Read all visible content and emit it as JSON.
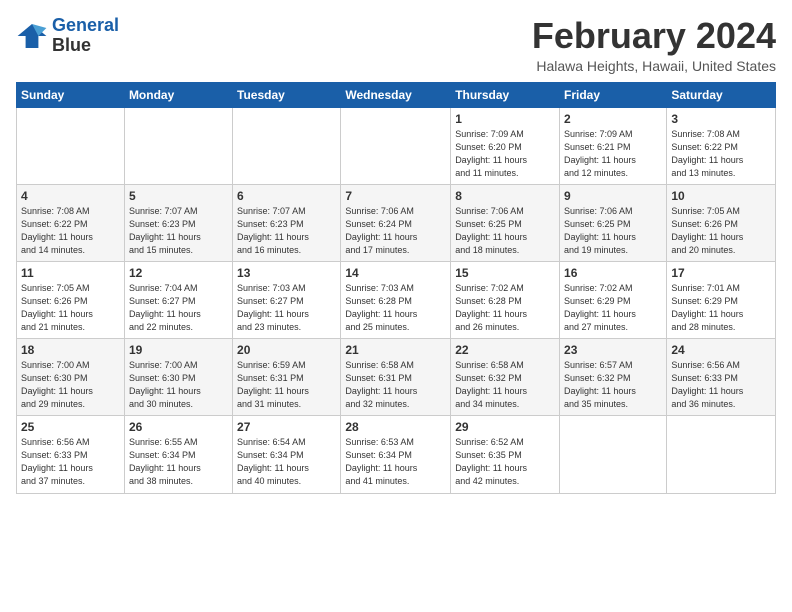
{
  "header": {
    "logo_line1": "General",
    "logo_line2": "Blue",
    "month_year": "February 2024",
    "location": "Halawa Heights, Hawaii, United States"
  },
  "calendar": {
    "days_of_week": [
      "Sunday",
      "Monday",
      "Tuesday",
      "Wednesday",
      "Thursday",
      "Friday",
      "Saturday"
    ],
    "weeks": [
      [
        {
          "day": "",
          "info": ""
        },
        {
          "day": "",
          "info": ""
        },
        {
          "day": "",
          "info": ""
        },
        {
          "day": "",
          "info": ""
        },
        {
          "day": "1",
          "info": "Sunrise: 7:09 AM\nSunset: 6:20 PM\nDaylight: 11 hours\nand 11 minutes."
        },
        {
          "day": "2",
          "info": "Sunrise: 7:09 AM\nSunset: 6:21 PM\nDaylight: 11 hours\nand 12 minutes."
        },
        {
          "day": "3",
          "info": "Sunrise: 7:08 AM\nSunset: 6:22 PM\nDaylight: 11 hours\nand 13 minutes."
        }
      ],
      [
        {
          "day": "4",
          "info": "Sunrise: 7:08 AM\nSunset: 6:22 PM\nDaylight: 11 hours\nand 14 minutes."
        },
        {
          "day": "5",
          "info": "Sunrise: 7:07 AM\nSunset: 6:23 PM\nDaylight: 11 hours\nand 15 minutes."
        },
        {
          "day": "6",
          "info": "Sunrise: 7:07 AM\nSunset: 6:23 PM\nDaylight: 11 hours\nand 16 minutes."
        },
        {
          "day": "7",
          "info": "Sunrise: 7:06 AM\nSunset: 6:24 PM\nDaylight: 11 hours\nand 17 minutes."
        },
        {
          "day": "8",
          "info": "Sunrise: 7:06 AM\nSunset: 6:25 PM\nDaylight: 11 hours\nand 18 minutes."
        },
        {
          "day": "9",
          "info": "Sunrise: 7:06 AM\nSunset: 6:25 PM\nDaylight: 11 hours\nand 19 minutes."
        },
        {
          "day": "10",
          "info": "Sunrise: 7:05 AM\nSunset: 6:26 PM\nDaylight: 11 hours\nand 20 minutes."
        }
      ],
      [
        {
          "day": "11",
          "info": "Sunrise: 7:05 AM\nSunset: 6:26 PM\nDaylight: 11 hours\nand 21 minutes."
        },
        {
          "day": "12",
          "info": "Sunrise: 7:04 AM\nSunset: 6:27 PM\nDaylight: 11 hours\nand 22 minutes."
        },
        {
          "day": "13",
          "info": "Sunrise: 7:03 AM\nSunset: 6:27 PM\nDaylight: 11 hours\nand 23 minutes."
        },
        {
          "day": "14",
          "info": "Sunrise: 7:03 AM\nSunset: 6:28 PM\nDaylight: 11 hours\nand 25 minutes."
        },
        {
          "day": "15",
          "info": "Sunrise: 7:02 AM\nSunset: 6:28 PM\nDaylight: 11 hours\nand 26 minutes."
        },
        {
          "day": "16",
          "info": "Sunrise: 7:02 AM\nSunset: 6:29 PM\nDaylight: 11 hours\nand 27 minutes."
        },
        {
          "day": "17",
          "info": "Sunrise: 7:01 AM\nSunset: 6:29 PM\nDaylight: 11 hours\nand 28 minutes."
        }
      ],
      [
        {
          "day": "18",
          "info": "Sunrise: 7:00 AM\nSunset: 6:30 PM\nDaylight: 11 hours\nand 29 minutes."
        },
        {
          "day": "19",
          "info": "Sunrise: 7:00 AM\nSunset: 6:30 PM\nDaylight: 11 hours\nand 30 minutes."
        },
        {
          "day": "20",
          "info": "Sunrise: 6:59 AM\nSunset: 6:31 PM\nDaylight: 11 hours\nand 31 minutes."
        },
        {
          "day": "21",
          "info": "Sunrise: 6:58 AM\nSunset: 6:31 PM\nDaylight: 11 hours\nand 32 minutes."
        },
        {
          "day": "22",
          "info": "Sunrise: 6:58 AM\nSunset: 6:32 PM\nDaylight: 11 hours\nand 34 minutes."
        },
        {
          "day": "23",
          "info": "Sunrise: 6:57 AM\nSunset: 6:32 PM\nDaylight: 11 hours\nand 35 minutes."
        },
        {
          "day": "24",
          "info": "Sunrise: 6:56 AM\nSunset: 6:33 PM\nDaylight: 11 hours\nand 36 minutes."
        }
      ],
      [
        {
          "day": "25",
          "info": "Sunrise: 6:56 AM\nSunset: 6:33 PM\nDaylight: 11 hours\nand 37 minutes."
        },
        {
          "day": "26",
          "info": "Sunrise: 6:55 AM\nSunset: 6:34 PM\nDaylight: 11 hours\nand 38 minutes."
        },
        {
          "day": "27",
          "info": "Sunrise: 6:54 AM\nSunset: 6:34 PM\nDaylight: 11 hours\nand 40 minutes."
        },
        {
          "day": "28",
          "info": "Sunrise: 6:53 AM\nSunset: 6:34 PM\nDaylight: 11 hours\nand 41 minutes."
        },
        {
          "day": "29",
          "info": "Sunrise: 6:52 AM\nSunset: 6:35 PM\nDaylight: 11 hours\nand 42 minutes."
        },
        {
          "day": "",
          "info": ""
        },
        {
          "day": "",
          "info": ""
        }
      ]
    ]
  }
}
